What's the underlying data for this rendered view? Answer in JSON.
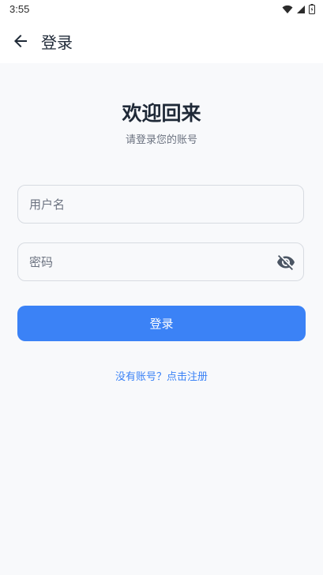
{
  "status_bar": {
    "time": "3:55",
    "icons": [
      "wifi-icon",
      "signal-icon",
      "battery-icon"
    ]
  },
  "app_bar": {
    "back_icon": "arrow-left-icon",
    "title": "登录"
  },
  "header": {
    "title": "欢迎回来",
    "subtitle": "请登录您的账号"
  },
  "form": {
    "username": {
      "value": "",
      "placeholder": "用户名"
    },
    "password": {
      "value": "",
      "placeholder": "密码",
      "toggle_icon": "eye-off-icon"
    },
    "login_label": "登录",
    "register_link": "没有账号？点击注册"
  },
  "colors": {
    "accent": "#3b82f6",
    "background": "#f8f9fb",
    "border": "#d7dbe1",
    "text_primary": "#1f2937",
    "text_secondary": "#6b7280"
  }
}
